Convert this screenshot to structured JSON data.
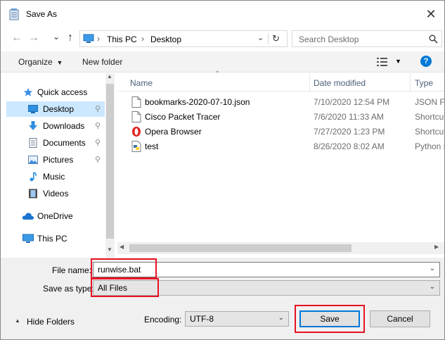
{
  "window": {
    "title": "Save As",
    "close_glyph": "✕"
  },
  "nav": {
    "back_glyph": "←",
    "forward_glyph": "→",
    "recent_glyph": "⌄",
    "up_glyph": "↑",
    "breadcrumb": [
      "This PC",
      "Desktop"
    ],
    "separator": "›",
    "search_placeholder": "Search Desktop"
  },
  "toolbar": {
    "organize_label": "Organize",
    "new_folder_label": "New folder",
    "help_glyph": "?"
  },
  "sidebar": {
    "items": [
      {
        "label": "Quick access",
        "icon": "star-icon"
      },
      {
        "label": "Desktop",
        "icon": "desktop-icon",
        "pinned": true,
        "selected": true
      },
      {
        "label": "Downloads",
        "icon": "download-icon",
        "pinned": true
      },
      {
        "label": "Documents",
        "icon": "documents-icon",
        "pinned": true
      },
      {
        "label": "Pictures",
        "icon": "pictures-icon",
        "pinned": true
      },
      {
        "label": "Music",
        "icon": "music-icon"
      },
      {
        "label": "Videos",
        "icon": "videos-icon"
      },
      {
        "label": "OneDrive",
        "icon": "cloud-icon"
      },
      {
        "label": "This PC",
        "icon": "computer-icon"
      }
    ],
    "pin_glyph": "📌"
  },
  "files": {
    "columns": [
      "Name",
      "Date modified",
      "Type"
    ],
    "rows": [
      {
        "name": "bookmarks-2020-07-10.json",
        "date": "7/10/2020 12:54 PM",
        "type": "JSON File",
        "icon": "file-icon"
      },
      {
        "name": "Cisco Packet Tracer",
        "date": "7/6/2020 11:33 AM",
        "type": "Shortcut",
        "icon": "file-icon"
      },
      {
        "name": "Opera Browser",
        "date": "7/27/2020 1:23 PM",
        "type": "Shortcut",
        "icon": "opera-icon"
      },
      {
        "name": "test",
        "date": "8/26/2020 8:02 AM",
        "type": "Python File",
        "icon": "python-file-icon"
      }
    ]
  },
  "form": {
    "file_name_label": "File name:",
    "file_name_value": "runwise.bat",
    "save_type_label": "Save as type:",
    "save_type_value": "All Files",
    "encoding_label": "Encoding:",
    "encoding_value": "UTF-8",
    "hide_folders_label": "Hide Folders",
    "save_label": "Save",
    "cancel_label": "Cancel"
  },
  "colors": {
    "selection": "#cce8ff",
    "highlight_box": "#e81123",
    "accent": "#0078d7"
  }
}
